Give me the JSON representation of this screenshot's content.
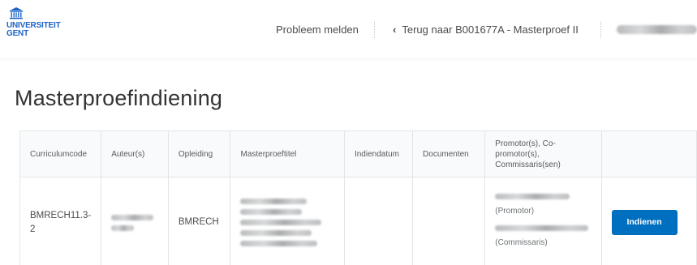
{
  "header": {
    "logo_line1": "UNIVERSITEIT",
    "logo_line2": "GENT",
    "report_link": "Probleem melden",
    "back_link": "Terug naar B001677A - Masterproef II",
    "brand_color": "#1e64c8"
  },
  "page": {
    "title": "Masterproefindiening"
  },
  "table": {
    "headers": {
      "curriculum": "Curriculumcode",
      "authors": "Auteur(s)",
      "program": "Opleiding",
      "thesis_title": "Masterproeftitel",
      "submit_date": "Indiendatum",
      "documents": "Documenten",
      "supervisors": "Promotor(s), Co-promotor(s), Commissaris(sen)"
    },
    "rows": [
      {
        "curriculum": "BMRECH11.3-2",
        "program": "BMRECH",
        "submit_date": "",
        "documents": "",
        "promotor_role": "(Promotor)",
        "commissaris_role": "(Commissaris)",
        "action_label": "Indienen"
      }
    ]
  },
  "colors": {
    "primary_button": "#006fbf",
    "header_bg": "#f9fafb"
  }
}
